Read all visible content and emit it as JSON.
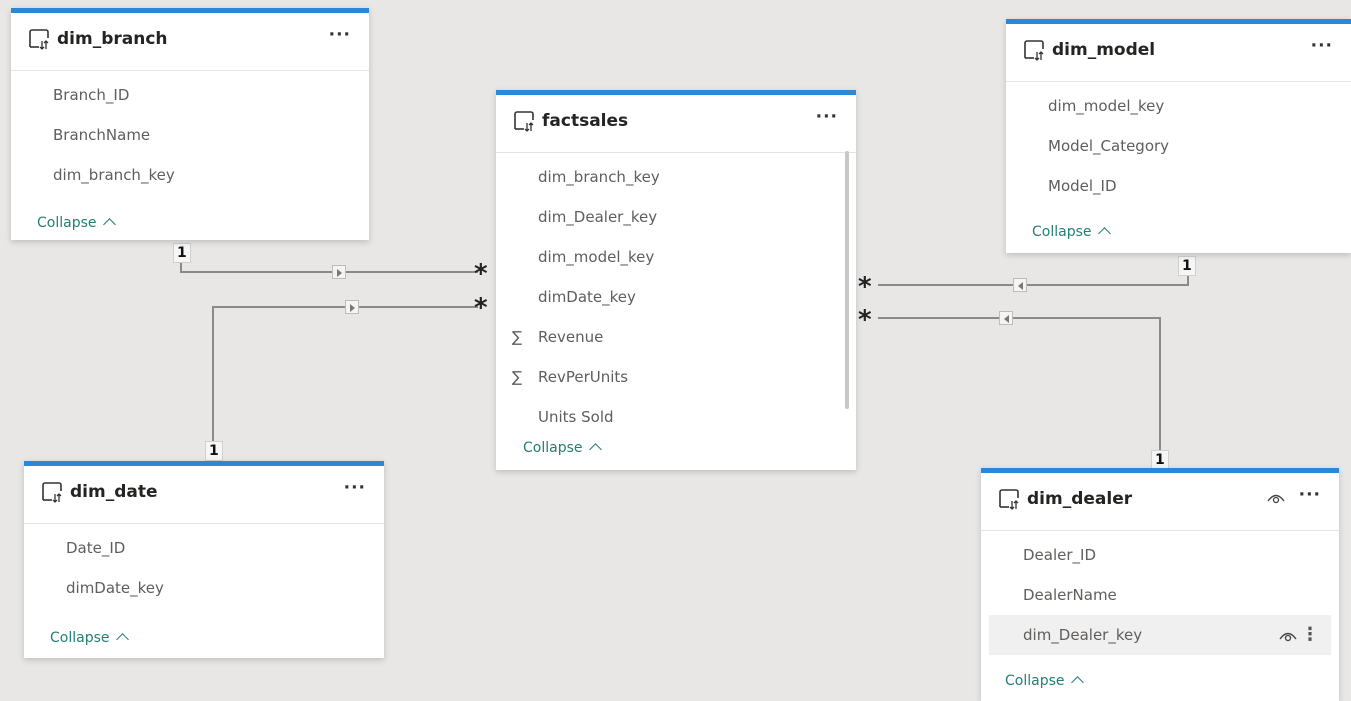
{
  "tables": {
    "dim_branch": {
      "title": "dim_branch",
      "fields": [
        "Branch_ID",
        "BranchName",
        "dim_branch_key"
      ],
      "collapse": "Collapse"
    },
    "factsales": {
      "title": "factsales",
      "fields": [
        "dim_branch_key",
        "dim_Dealer_key",
        "dim_model_key",
        "dimDate_key",
        "Revenue",
        "RevPerUnits",
        "Units Sold"
      ],
      "measure_symbol": "∑",
      "collapse": "Collapse"
    },
    "dim_model": {
      "title": "dim_model",
      "fields": [
        "dim_model_key",
        "Model_Category",
        "Model_ID"
      ],
      "collapse": "Collapse"
    },
    "dim_date": {
      "title": "dim_date",
      "fields": [
        "Date_ID",
        "dimDate_key"
      ],
      "collapse": "Collapse"
    },
    "dim_dealer": {
      "title": "dim_dealer",
      "fields": [
        "Dealer_ID",
        "DealerName",
        "dim_Dealer_key"
      ],
      "collapse": "Collapse"
    }
  },
  "more_glyph": "···",
  "vmore_glyph": "⋮",
  "cardinality": {
    "one": "1",
    "many": "*"
  },
  "relationships": [
    {
      "from": "dim_branch",
      "to": "factsales",
      "from_card": "1",
      "to_card": "*"
    },
    {
      "from": "dim_date",
      "to": "factsales",
      "from_card": "1",
      "to_card": "*"
    },
    {
      "from": "dim_model",
      "to": "factsales",
      "from_card": "1",
      "to_card": "*"
    },
    {
      "from": "dim_dealer",
      "to": "factsales",
      "from_card": "1",
      "to_card": "*"
    }
  ],
  "colors": {
    "header_accent": "#2b88d8",
    "background": "#e8e7e5",
    "line": "#8a8a8a",
    "collapse_link": "#257e73"
  },
  "icons": {
    "table": "table-icon",
    "eye": "eye-icon",
    "more": "more-options-icon",
    "arrow": "filter-direction-arrow-icon",
    "sigma": "sum-measure-icon"
  }
}
